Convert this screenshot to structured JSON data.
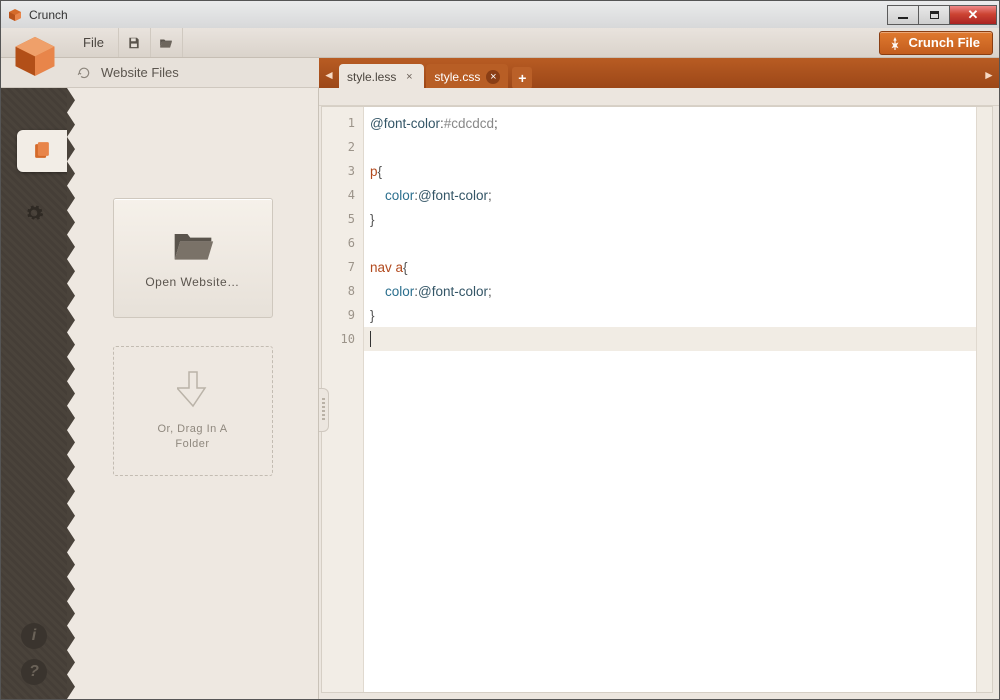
{
  "window": {
    "title": "Crunch"
  },
  "menu": {
    "file": "File"
  },
  "actions": {
    "crunch_file": "Crunch File"
  },
  "sidebar": {
    "header": "Website Files",
    "open_label": "Open Website…",
    "drag_label": "Or, Drag In A\nFolder"
  },
  "tabs": [
    {
      "label": "style.less",
      "active": true
    },
    {
      "label": "style.css",
      "active": false
    }
  ],
  "editor": {
    "lines": [
      {
        "n": 1,
        "tokens": [
          [
            "var",
            "@font-color"
          ],
          [
            "punc",
            ":"
          ],
          [
            "hex",
            "#cdcdcd"
          ],
          [
            "punc",
            ";"
          ]
        ]
      },
      {
        "n": 2,
        "tokens": []
      },
      {
        "n": 3,
        "tokens": [
          [
            "tag",
            "p"
          ],
          [
            "punc",
            "{"
          ]
        ]
      },
      {
        "n": 4,
        "tokens": [
          [
            "indent",
            "    "
          ],
          [
            "prop",
            "color"
          ],
          [
            "punc",
            ":"
          ],
          [
            "var",
            "@font-color"
          ],
          [
            "punc",
            ";"
          ]
        ]
      },
      {
        "n": 5,
        "tokens": [
          [
            "punc",
            "}"
          ]
        ]
      },
      {
        "n": 6,
        "tokens": []
      },
      {
        "n": 7,
        "tokens": [
          [
            "tag",
            "nav a"
          ],
          [
            "punc",
            "{"
          ]
        ]
      },
      {
        "n": 8,
        "tokens": [
          [
            "indent",
            "    "
          ],
          [
            "prop",
            "color"
          ],
          [
            "punc",
            ":"
          ],
          [
            "var",
            "@font-color"
          ],
          [
            "punc",
            ";"
          ]
        ]
      },
      {
        "n": 9,
        "tokens": [
          [
            "punc",
            "}"
          ]
        ]
      },
      {
        "n": 10,
        "tokens": [],
        "active": true
      }
    ]
  },
  "colors": {
    "accent": "#c35d1e",
    "tabbar": "#a84e1c"
  },
  "rail": {
    "info_glyph": "i",
    "help_glyph": "?"
  }
}
